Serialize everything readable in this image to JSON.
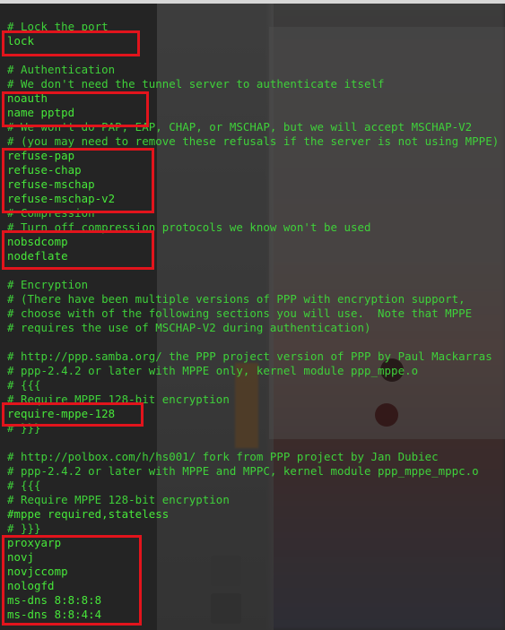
{
  "terminal": {
    "lines": [
      "# Lock the port",
      "lock",
      "",
      "# Authentication",
      "# We don't need the tunnel server to authenticate itself",
      "noauth",
      "name pptpd",
      "# We won't do PAP, EAP, CHAP, or MSCHAP, but we will accept MSCHAP-V2",
      "# (you may need to remove these refusals if the server is not using MPPE)",
      "refuse-pap",
      "refuse-chap",
      "refuse-mschap",
      "refuse-mschap-v2",
      "# Compression",
      "# Turn off compression protocols we know won't be used",
      "nobsdcomp",
      "nodeflate",
      "",
      "# Encryption",
      "# (There have been multiple versions of PPP with encryption support,",
      "# choose with of the following sections you will use.  Note that MPPE",
      "# requires the use of MSCHAP-V2 during authentication)",
      "",
      "# http://ppp.samba.org/ the PPP project version of PPP by Paul Mackarras",
      "# ppp-2.4.2 or later with MPPE only, kernel module ppp_mppe.o",
      "# {{{",
      "# Require MPPE 128-bit encryption",
      "require-mppe-128",
      "# }}}",
      "",
      "# http://polbox.com/h/hs001/ fork from PPP project by Jan Dubiec",
      "# ppp-2.4.2 or later with MPPE and MPPC, kernel module ppp_mppe_mppc.o",
      "# {{{",
      "# Require MPPE 128-bit encryption",
      "#mppe required,stateless",
      "# }}}",
      "proxyarp",
      "novj",
      "novjccomp",
      "nologfd",
      "ms-dns 8:8:8:8",
      "ms-dns 8:8:4:4"
    ]
  },
  "colors": {
    "text": "#47e83a",
    "highlight_border": "#e2141c"
  }
}
